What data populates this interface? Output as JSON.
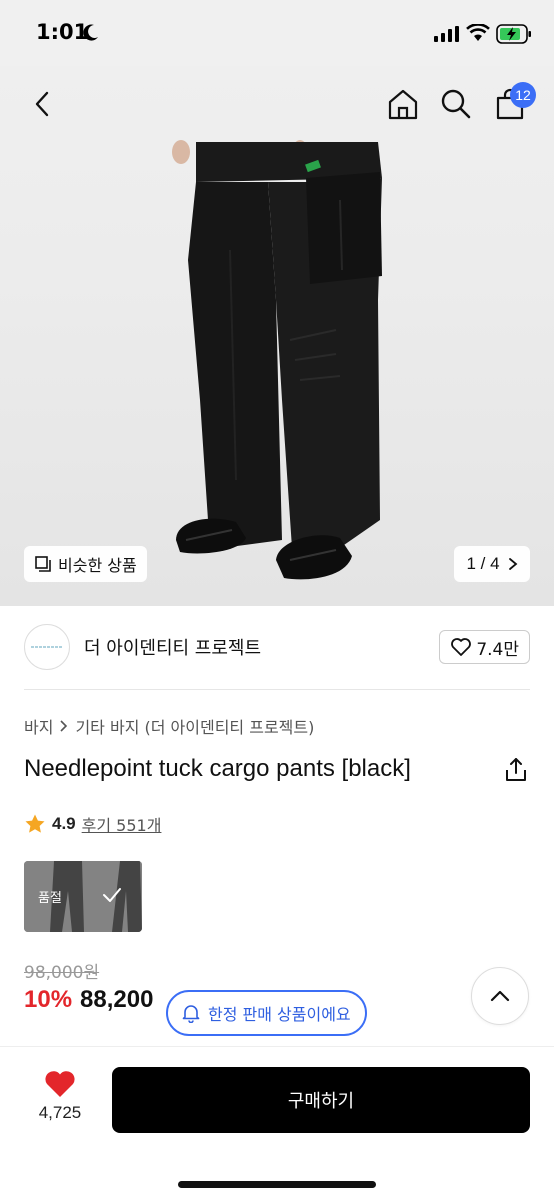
{
  "status_bar": {
    "time": "1:01"
  },
  "nav": {
    "cart_count": "12"
  },
  "gallery": {
    "similar_label": "비슷한 상품",
    "page_indicator": "1 / 4"
  },
  "brand": {
    "name": "더 아이덴티티 프로젝트",
    "likes": "7.4만"
  },
  "breadcrumb": {
    "category": "바지",
    "subcategory": "기타 바지 (더 아이덴티티 프로젝트)"
  },
  "product": {
    "title": "Needlepoint tuck cargo pants [black]",
    "rating": "4.9",
    "reviews": "후기 551개",
    "option_soldout": "품절"
  },
  "price": {
    "original": "98,000원",
    "discount": "10%",
    "sale": "88,200"
  },
  "limited_notice": "한정 판매 상품이에요",
  "bottom": {
    "wish_count": "4,725",
    "buy_label": "구매하기"
  },
  "colors": {
    "accent_blue": "#3b6ef6",
    "discount_red": "#e3262b",
    "heart_red": "#e3262b"
  }
}
